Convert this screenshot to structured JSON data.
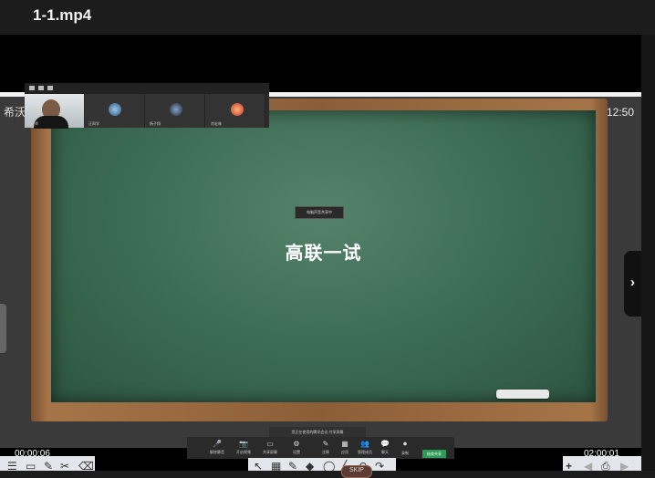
{
  "window": {
    "title": "1-1.mp4"
  },
  "screen": {
    "app_name": "希沃",
    "clock": "12:50",
    "board_title": "高联一试",
    "notice": "电脑声音共享中",
    "participants": [
      {
        "name": "肖老师"
      },
      {
        "name": "汪同学"
      },
      {
        "name": "杨子翔"
      },
      {
        "name": "肖宏林"
      }
    ],
    "meeting_banner": "您正在使用的腾讯会议 共享屏幕",
    "meeting_tools": [
      {
        "label": "解除静音",
        "icon": "🎤"
      },
      {
        "label": "开启视频",
        "icon": "📷"
      },
      {
        "label": "共享屏幕",
        "icon": "▭"
      },
      {
        "label": "注释",
        "icon": "✎"
      },
      {
        "label": "应用",
        "icon": "▦"
      },
      {
        "label": "管理成员",
        "icon": "👥"
      },
      {
        "label": "聊天",
        "icon": "💬"
      },
      {
        "label": "录制",
        "icon": "⏺"
      },
      {
        "label": "设置",
        "icon": "⚙"
      }
    ],
    "end_button": "结束共享",
    "left_tool_icons": [
      "☰",
      "▭",
      "✎",
      "✂",
      "⌫"
    ],
    "mid_tool_icons": [
      "↖",
      "▦",
      "✎",
      "◆",
      "◯",
      "╱",
      "↶",
      "↷"
    ],
    "right_tool_icons": [
      "+",
      "◀",
      "⎙",
      "▶"
    ]
  },
  "player": {
    "current_time": "00:00:06",
    "total_time": "02:00:01",
    "skip_label": "SKIP",
    "next_arrow": "›"
  },
  "colors": {
    "board": "#3b6a52",
    "frame": "#a57548",
    "green_button": "#2d9a55"
  }
}
